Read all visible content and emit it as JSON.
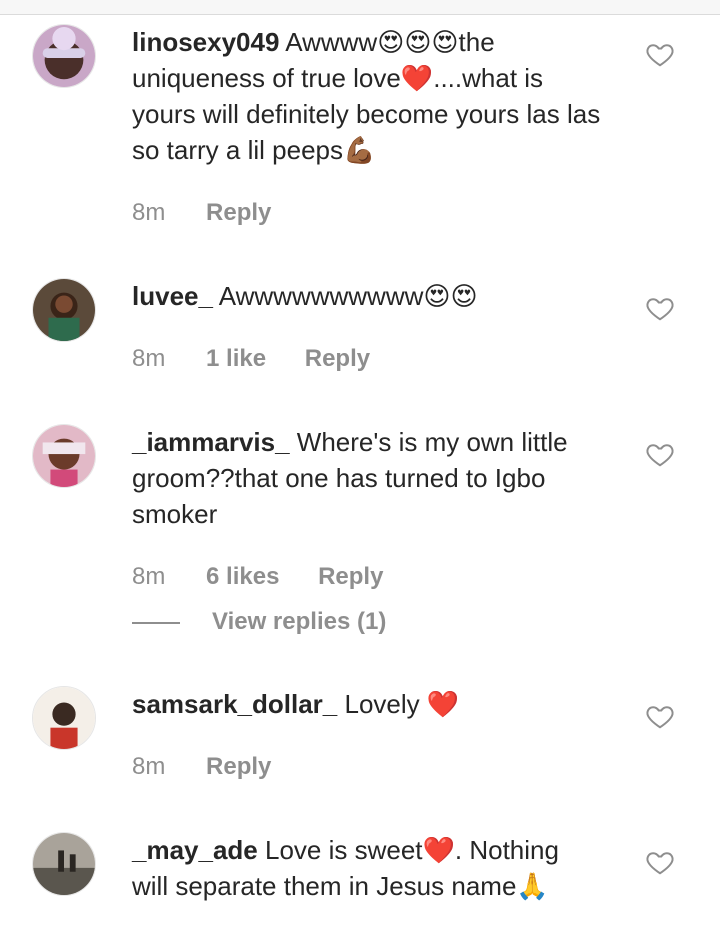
{
  "comments": [
    {
      "username": "linosexy049",
      "text": "Awwww😍😍😍the uniqueness of true love❤️....what is yours will definitely become yours las las so tarry a lil peeps💪🏾",
      "time": "8m",
      "likes": "",
      "reply": "Reply"
    },
    {
      "username": "luvee_",
      "text": "Awwwwwwwwww😍😍",
      "time": "8m",
      "likes": "1 like",
      "reply": "Reply"
    },
    {
      "username": "_iammarvis_",
      "text": "Where's is my own little groom??that one has turned to Igbo smoker",
      "time": "8m",
      "likes": "6 likes",
      "reply": "Reply",
      "view_replies": "View replies (1)"
    },
    {
      "username": "samsark_dollar_",
      "text": "Lovely ❤️",
      "time": "8m",
      "likes": "",
      "reply": "Reply"
    },
    {
      "username": "_may_ade",
      "text": "Love is sweet❤️. Nothing will separate them in Jesus name🙏",
      "time": "",
      "likes": "",
      "reply": ""
    }
  ],
  "icons": {
    "like": "heart-outline-icon"
  },
  "colors": {
    "text": "#262626",
    "secondary": "#8e8e8e"
  }
}
